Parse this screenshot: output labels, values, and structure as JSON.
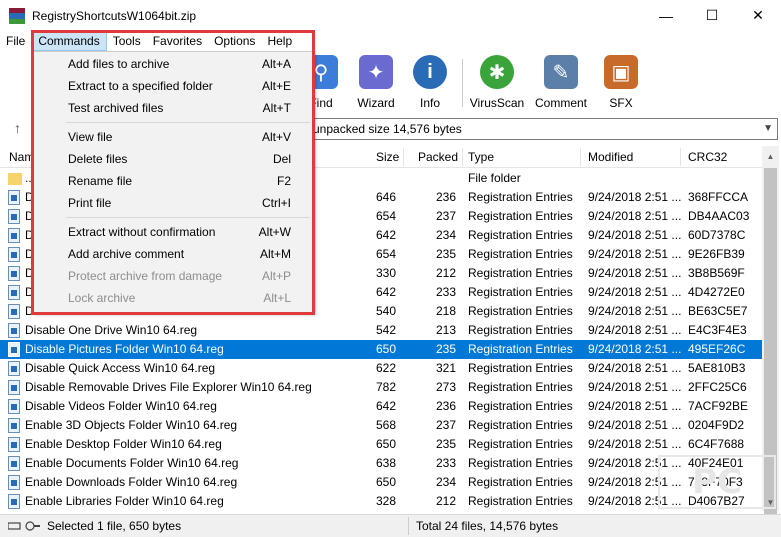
{
  "window": {
    "title": "RegistryShortcutsW1064bit.zip",
    "minimize": "—",
    "maximize": "☐",
    "close": "✕"
  },
  "menubar": [
    "File",
    "Commands",
    "Tools",
    "Favorites",
    "Options",
    "Help"
  ],
  "toolbar": [
    {
      "label": "Find",
      "icon": "magnifier-icon",
      "color": "#3b7dd8"
    },
    {
      "label": "Wizard",
      "icon": "magic-wand-icon",
      "color": "#6a6ad0"
    },
    {
      "label": "Info",
      "icon": "info-icon",
      "color": "#2a6bb5"
    },
    {
      "label": "VirusScan",
      "icon": "bug-icon",
      "color": "#3aa33a"
    },
    {
      "label": "Comment",
      "icon": "comment-icon",
      "color": "#5b7fa8"
    },
    {
      "label": "SFX",
      "icon": "sfx-box-icon",
      "color": "#c76a2a"
    }
  ],
  "address": {
    "text": "unpacked size 14,576 bytes"
  },
  "columns": {
    "name": "Name",
    "size": "Size",
    "packed": "Packed",
    "type": "Type",
    "modified": "Modified",
    "crc": "CRC32"
  },
  "rows": [
    {
      "name": "..",
      "size": "",
      "packed": "",
      "type": "File folder",
      "modified": "",
      "crc": "",
      "folder": true
    },
    {
      "name": "D",
      "size": "646",
      "packed": "236",
      "type": "Registration Entries",
      "modified": "9/24/2018 2:51 ...",
      "crc": "368FFCCA"
    },
    {
      "name": "D",
      "size": "654",
      "packed": "237",
      "type": "Registration Entries",
      "modified": "9/24/2018 2:51 ...",
      "crc": "DB4AAC03"
    },
    {
      "name": "D",
      "size": "642",
      "packed": "234",
      "type": "Registration Entries",
      "modified": "9/24/2018 2:51 ...",
      "crc": "60D7378C"
    },
    {
      "name": "D",
      "size": "654",
      "packed": "235",
      "type": "Registration Entries",
      "modified": "9/24/2018 2:51 ...",
      "crc": "9E26FB39"
    },
    {
      "name": "D",
      "size": "330",
      "packed": "212",
      "type": "Registration Entries",
      "modified": "9/24/2018 2:51 ...",
      "crc": "3B8B569F"
    },
    {
      "name": "D",
      "size": "642",
      "packed": "233",
      "type": "Registration Entries",
      "modified": "9/24/2018 2:51 ...",
      "crc": "4D4272E0"
    },
    {
      "name": "D",
      "size": "540",
      "packed": "218",
      "type": "Registration Entries",
      "modified": "9/24/2018 2:51 ...",
      "crc": "BE63C5E7"
    },
    {
      "name": "Disable One Drive Win10 64.reg",
      "size": "542",
      "packed": "213",
      "type": "Registration Entries",
      "modified": "9/24/2018 2:51 ...",
      "crc": "E4C3F4E3"
    },
    {
      "name": "Disable Pictures Folder Win10 64.reg",
      "size": "650",
      "packed": "235",
      "type": "Registration Entries",
      "modified": "9/24/2018 2:51 ...",
      "crc": "495EF26C",
      "selected": true
    },
    {
      "name": "Disable Quick Access Win10 64.reg",
      "size": "622",
      "packed": "321",
      "type": "Registration Entries",
      "modified": "9/24/2018 2:51 ...",
      "crc": "5AE810B3"
    },
    {
      "name": "Disable Removable Drives File Explorer Win10 64.reg",
      "size": "782",
      "packed": "273",
      "type": "Registration Entries",
      "modified": "9/24/2018 2:51 ...",
      "crc": "2FFC25C6"
    },
    {
      "name": "Disable Videos Folder Win10 64.reg",
      "size": "642",
      "packed": "236",
      "type": "Registration Entries",
      "modified": "9/24/2018 2:51 ...",
      "crc": "7ACF92BE"
    },
    {
      "name": "Enable 3D Objects Folder Win10 64.reg",
      "size": "568",
      "packed": "237",
      "type": "Registration Entries",
      "modified": "9/24/2018 2:51 ...",
      "crc": "0204F9D2"
    },
    {
      "name": "Enable Desktop Folder Win10 64.reg",
      "size": "650",
      "packed": "235",
      "type": "Registration Entries",
      "modified": "9/24/2018 2:51 ...",
      "crc": "6C4F7688"
    },
    {
      "name": "Enable Documents Folder Win10 64.reg",
      "size": "638",
      "packed": "233",
      "type": "Registration Entries",
      "modified": "9/24/2018 2:51 ...",
      "crc": "40F24E01"
    },
    {
      "name": "Enable Downloads Folder Win10 64.reg",
      "size": "650",
      "packed": "234",
      "type": "Registration Entries",
      "modified": "9/24/2018 2:51 ...",
      "crc": "738F70F3"
    },
    {
      "name": "Enable Libraries Folder Win10 64.reg",
      "size": "328",
      "packed": "212",
      "type": "Registration Entries",
      "modified": "9/24/2018 2:51 ...",
      "crc": "D4067B27"
    }
  ],
  "commands_menu": [
    {
      "label": "Add files to archive",
      "shortcut": "Alt+A"
    },
    {
      "label": "Extract to a specified folder",
      "shortcut": "Alt+E"
    },
    {
      "label": "Test archived files",
      "shortcut": "Alt+T"
    },
    {
      "sep": true
    },
    {
      "label": "View file",
      "shortcut": "Alt+V"
    },
    {
      "label": "Delete files",
      "shortcut": "Del"
    },
    {
      "label": "Rename file",
      "shortcut": "F2"
    },
    {
      "label": "Print file",
      "shortcut": "Ctrl+I"
    },
    {
      "sep": true
    },
    {
      "label": "Extract without confirmation",
      "shortcut": "Alt+W"
    },
    {
      "label": "Add archive comment",
      "shortcut": "Alt+M"
    },
    {
      "label": "Protect archive from damage",
      "shortcut": "Alt+P",
      "disabled": true
    },
    {
      "label": "Lock archive",
      "shortcut": "Alt+L",
      "disabled": true
    }
  ],
  "status": {
    "left": "Selected 1 file, 650 bytes",
    "right": "Total 24 files, 14,576 bytes"
  },
  "colors": {
    "selection": "#0078d7",
    "highlight_border": "#e0393e",
    "menu_active": "#cce4f7"
  }
}
